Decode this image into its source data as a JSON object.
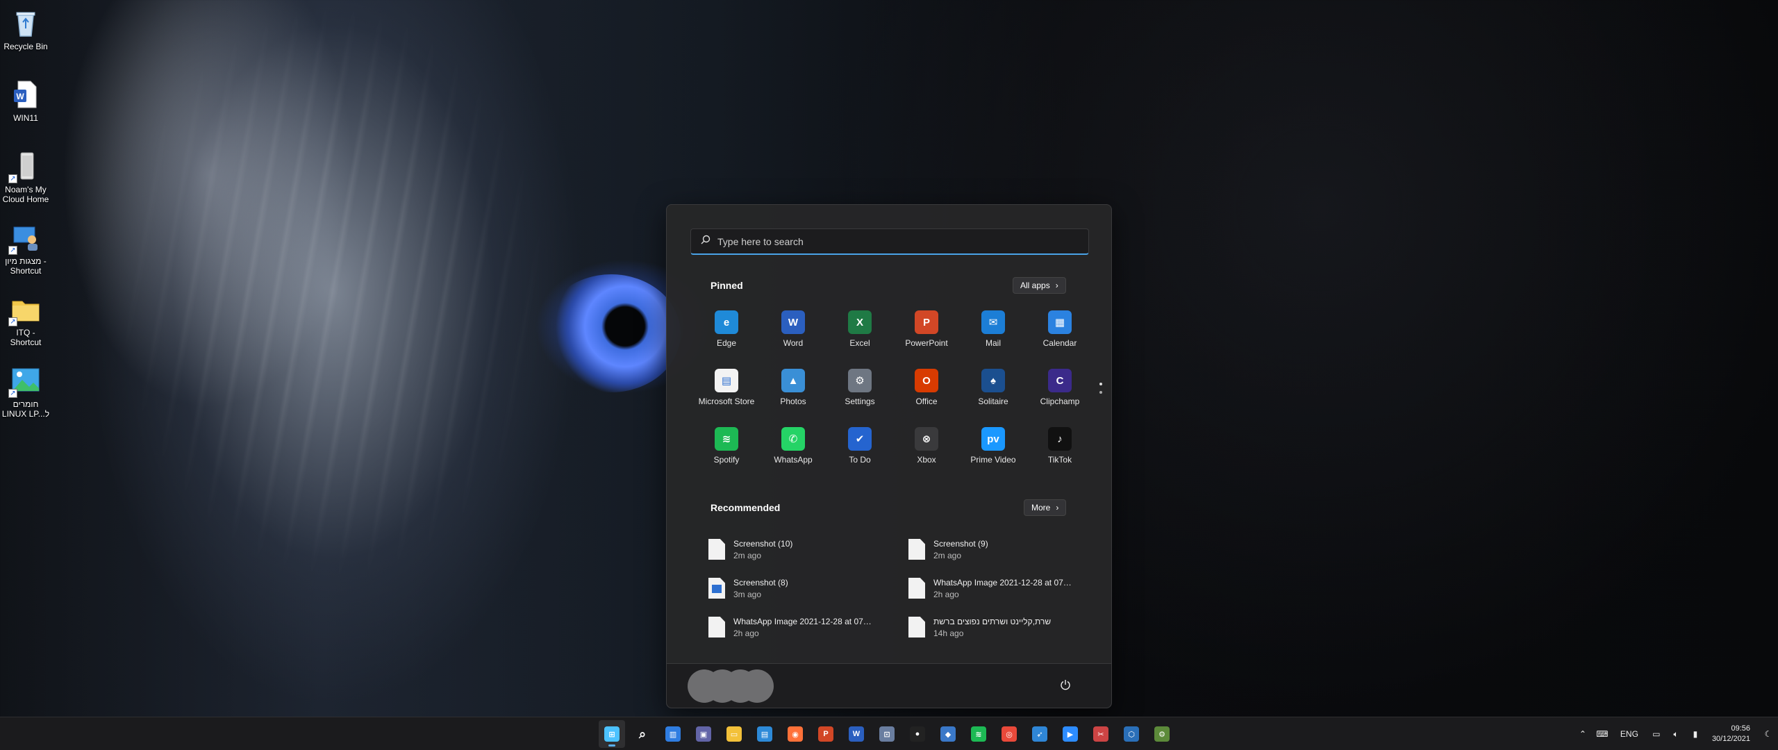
{
  "desktop": {
    "icons": [
      {
        "label": "Recycle Bin",
        "icon": "recycle-bin-icon"
      },
      {
        "label": "WIN11",
        "icon": "word-document-icon"
      },
      {
        "label": "Noam's My Cloud Home",
        "icon": "drive-shortcut-icon"
      },
      {
        "label": "מצגות מיון - Shortcut",
        "icon": "shortcut-icon"
      },
      {
        "label": "ITQ - Shortcut",
        "icon": "folder-icon"
      },
      {
        "label": "חומרים LINUX LP...ל",
        "icon": "image-shortcut-icon"
      }
    ]
  },
  "start_menu": {
    "search_placeholder": "Type here to search",
    "pinned_title": "Pinned",
    "all_apps_label": "All apps",
    "pinned_apps": [
      {
        "label": "Edge",
        "icon": "edge-icon",
        "color": "#1f8ad8",
        "glyph": "e"
      },
      {
        "label": "Word",
        "icon": "word-icon",
        "color": "#2b5fbf",
        "glyph": "W"
      },
      {
        "label": "Excel",
        "icon": "excel-icon",
        "color": "#1f7a45",
        "glyph": "X"
      },
      {
        "label": "PowerPoint",
        "icon": "powerpoint-icon",
        "color": "#d24726",
        "glyph": "P"
      },
      {
        "label": "Mail",
        "icon": "mail-icon",
        "color": "#1c7ed6",
        "glyph": "✉"
      },
      {
        "label": "Calendar",
        "icon": "calendar-icon",
        "color": "#2b82e0",
        "glyph": "▦"
      },
      {
        "label": "Microsoft Store",
        "icon": "store-icon",
        "color": "#f3f3f3",
        "glyph": "▤"
      },
      {
        "label": "Photos",
        "icon": "photos-icon",
        "color": "#3a8fd6",
        "glyph": "▲"
      },
      {
        "label": "Settings",
        "icon": "settings-icon",
        "color": "#6e7682",
        "glyph": "⚙"
      },
      {
        "label": "Office",
        "icon": "office-icon",
        "color": "#d83b01",
        "glyph": "O"
      },
      {
        "label": "Solitaire",
        "icon": "solitaire-icon",
        "color": "#1b4f8f",
        "glyph": "♠"
      },
      {
        "label": "Clipchamp",
        "icon": "clipchamp-icon",
        "color": "#3b2a8a",
        "glyph": "C"
      },
      {
        "label": "Spotify",
        "icon": "spotify-icon",
        "color": "#1db954",
        "glyph": "≋"
      },
      {
        "label": "WhatsApp",
        "icon": "whatsapp-icon",
        "color": "#25d366",
        "glyph": "✆"
      },
      {
        "label": "To Do",
        "icon": "todo-icon",
        "color": "#2564cf",
        "glyph": "✔"
      },
      {
        "label": "Xbox",
        "icon": "xbox-icon",
        "color": "#3a3a3c",
        "glyph": "⊗"
      },
      {
        "label": "Prime Video",
        "icon": "prime-video-icon",
        "color": "#1a98ff",
        "glyph": "pv"
      },
      {
        "label": "TikTok",
        "icon": "tiktok-icon",
        "color": "#111111",
        "glyph": "♪"
      }
    ],
    "recommended_title": "Recommended",
    "more_label": "More",
    "recommended": [
      {
        "name": "Screenshot (10)",
        "time": "2m ago",
        "type": "file"
      },
      {
        "name": "Screenshot (9)",
        "time": "2m ago",
        "type": "file"
      },
      {
        "name": "Screenshot (8)",
        "time": "3m ago",
        "type": "image"
      },
      {
        "name": "WhatsApp Image 2021-12-28 at 07....",
        "time": "2h ago",
        "type": "file"
      },
      {
        "name": "WhatsApp Image 2021-12-28 at 07....",
        "time": "2h ago",
        "type": "file"
      },
      {
        "name": "שרת,קליינט ושרתים נפוצים ברשת",
        "time": "14h ago",
        "type": "file"
      }
    ]
  },
  "taskbar": {
    "apps": [
      {
        "icon": "start-icon",
        "color": "#4cc2ff",
        "glyph": "⊞",
        "active": true
      },
      {
        "icon": "search-icon",
        "color": "transparent",
        "glyph": "⌕",
        "active": false
      },
      {
        "icon": "widgets-icon",
        "color": "#2f7de1",
        "glyph": "▥",
        "active": false
      },
      {
        "icon": "teams-chat-icon",
        "color": "#6264a7",
        "glyph": "▣",
        "active": false
      },
      {
        "icon": "file-explorer-icon",
        "color": "#f3c13a",
        "glyph": "▭",
        "active": false
      },
      {
        "icon": "store-icon",
        "color": "#2d8ad8",
        "glyph": "▤",
        "active": false
      },
      {
        "icon": "firefox-icon",
        "color": "#ff7139",
        "glyph": "◉",
        "active": false
      },
      {
        "icon": "powerpoint-icon",
        "color": "#d24726",
        "glyph": "P",
        "active": false
      },
      {
        "icon": "word-icon",
        "color": "#2b5fbf",
        "glyph": "W",
        "active": false
      },
      {
        "icon": "network-app-icon",
        "color": "#6a7ea0",
        "glyph": "⊡",
        "active": false
      },
      {
        "icon": "record-icon",
        "color": "#222222",
        "glyph": "●",
        "active": false
      },
      {
        "icon": "vscode-like-icon",
        "color": "#3a78c8",
        "glyph": "◆",
        "active": false
      },
      {
        "icon": "spotify-icon",
        "color": "#1db954",
        "glyph": "≋",
        "active": false
      },
      {
        "icon": "chrome-icon",
        "color": "#e9493a",
        "glyph": "◎",
        "active": false
      },
      {
        "icon": "feather-app-icon",
        "color": "#2f86d6",
        "glyph": "➶",
        "active": false
      },
      {
        "icon": "zoom-icon",
        "color": "#2d8cff",
        "glyph": "▶",
        "active": false
      },
      {
        "icon": "snipping-tool-icon",
        "color": "#c44",
        "glyph": "✂",
        "active": false
      },
      {
        "icon": "virtualbox-icon",
        "color": "#2a6fb8",
        "glyph": "⬡",
        "active": false
      },
      {
        "icon": "vm-app-icon",
        "color": "#5c8a3a",
        "glyph": "⚙",
        "active": false
      }
    ],
    "language": "ENG",
    "time": "09:56",
    "date": "30/12/2021"
  }
}
